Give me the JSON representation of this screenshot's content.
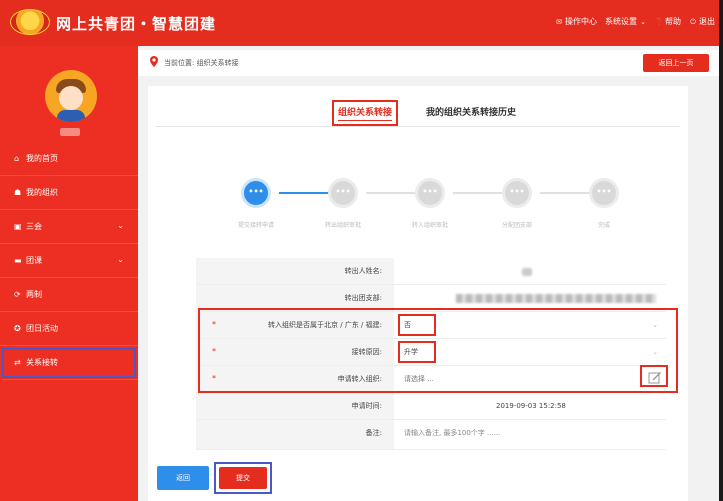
{
  "header": {
    "title": "网上共青团・智慧团建",
    "links": [
      {
        "label": "操作中心",
        "icon": "mail-icon"
      },
      {
        "label": "系统设置",
        "icon": "chevron-down-icon"
      },
      {
        "label": "帮助",
        "icon": "help-icon"
      },
      {
        "label": "退出",
        "icon": "power-icon"
      }
    ]
  },
  "sidebar": {
    "items": [
      {
        "label": "我的首页",
        "icon": "home-icon"
      },
      {
        "label": "我的组织",
        "icon": "people-icon"
      },
      {
        "label": "三会",
        "icon": "list-icon",
        "expandable": true
      },
      {
        "label": "团课",
        "icon": "folder-icon",
        "expandable": true
      },
      {
        "label": "两制",
        "icon": "refresh-icon"
      },
      {
        "label": "团日活动",
        "icon": "activity-icon"
      },
      {
        "label": "关系接转",
        "icon": "transfer-icon",
        "highlighted": true
      }
    ]
  },
  "breadcrumb": {
    "text": "当前位置: 组织关系转接",
    "back_button": "返回上一页"
  },
  "tabs": [
    {
      "label": "组织关系转接",
      "active": true
    },
    {
      "label": "我的组织关系转接历史",
      "active": false
    }
  ],
  "steps": [
    {
      "label": "提交接转申请",
      "icon": "•••",
      "active": true
    },
    {
      "label": "转出组织审批",
      "icon": "•••",
      "active": false
    },
    {
      "label": "转入组织审批",
      "icon": "•••",
      "active": false
    },
    {
      "label": "分配团支部",
      "icon": "•••",
      "active": false
    },
    {
      "label": "完成",
      "icon": "•••",
      "active": false
    }
  ],
  "form": {
    "out_person_label": "转出人姓名:",
    "out_branch_label": "转出团支部:",
    "region_label": "转入组织是否属于北京 / 广东 / 福建:",
    "region_value": "否",
    "reason_label": "接转原因:",
    "reason_value": "升学",
    "target_label": "申请转入组织:",
    "target_placeholder": "请选择 ...",
    "time_label": "申请时间:",
    "time_value": "2019-09-03 15:2:58",
    "note_label": "备注:",
    "note_placeholder": "请输入备注, 最多100个字 ......",
    "required_mark": "*"
  },
  "buttons": {
    "back": "返回",
    "submit": "提交"
  },
  "colors": {
    "brand_red": "#e52d1f",
    "step_blue": "#2d8fea",
    "highlight_blue": "#4b58c9"
  }
}
